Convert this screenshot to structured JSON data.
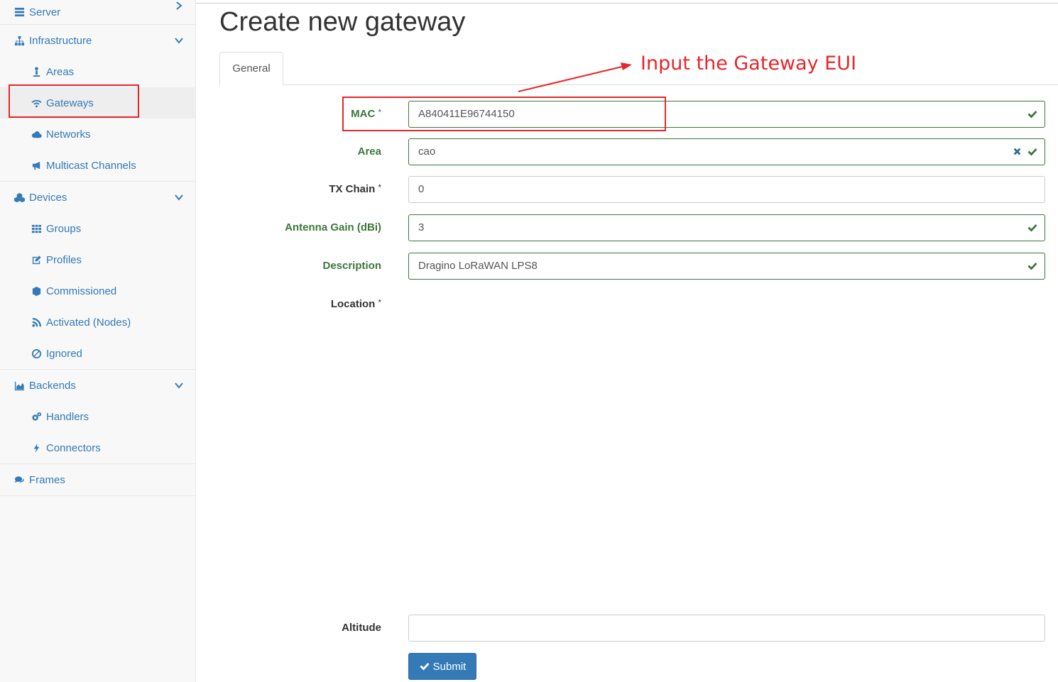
{
  "sidebar": {
    "server": {
      "label": "Server",
      "icon": "server-icon"
    },
    "infrastructure": {
      "label": "Infrastructure",
      "icon": "sitemap-icon",
      "items": [
        {
          "label": "Areas",
          "icon": "user-pin-icon"
        },
        {
          "label": "Gateways",
          "icon": "wifi-icon"
        },
        {
          "label": "Networks",
          "icon": "cloud-icon"
        },
        {
          "label": "Multicast Channels",
          "icon": "bullhorn-icon"
        }
      ]
    },
    "devices": {
      "label": "Devices",
      "icon": "cubes-icon",
      "items": [
        {
          "label": "Groups",
          "icon": "grid-icon"
        },
        {
          "label": "Profiles",
          "icon": "edit-icon"
        },
        {
          "label": "Commissioned",
          "icon": "cube-icon"
        },
        {
          "label": "Activated (Nodes)",
          "icon": "rss-icon"
        },
        {
          "label": "Ignored",
          "icon": "ban-icon"
        }
      ]
    },
    "backends": {
      "label": "Backends",
      "icon": "area-chart-icon",
      "items": [
        {
          "label": "Handlers",
          "icon": "cogs-icon"
        },
        {
          "label": "Connectors",
          "icon": "bolt-icon"
        }
      ]
    },
    "frames": {
      "label": "Frames",
      "icon": "comments-icon"
    }
  },
  "page": {
    "title": "Create new gateway",
    "tab_general": "General"
  },
  "form": {
    "mac": {
      "label": "MAC",
      "required": "*",
      "value": "A840411E96744150"
    },
    "area": {
      "label": "Area",
      "value": "cao"
    },
    "tx_chain": {
      "label": "TX Chain",
      "required": "*",
      "value": "0"
    },
    "antenna_gain": {
      "label": "Antenna Gain (dBi)",
      "value": "3"
    },
    "description": {
      "label": "Description",
      "value": "Dragino LoRaWAN LPS8"
    },
    "location": {
      "label": "Location",
      "required": "*"
    },
    "altitude": {
      "label": "Altitude",
      "value": ""
    },
    "submit_label": "Submit"
  },
  "annotation": {
    "text": "Input the Gateway EUI"
  },
  "colors": {
    "link": "#337ab7",
    "success": "#3c763d",
    "annotation_red": "#e8262a",
    "primary_button": "#337ab7"
  }
}
